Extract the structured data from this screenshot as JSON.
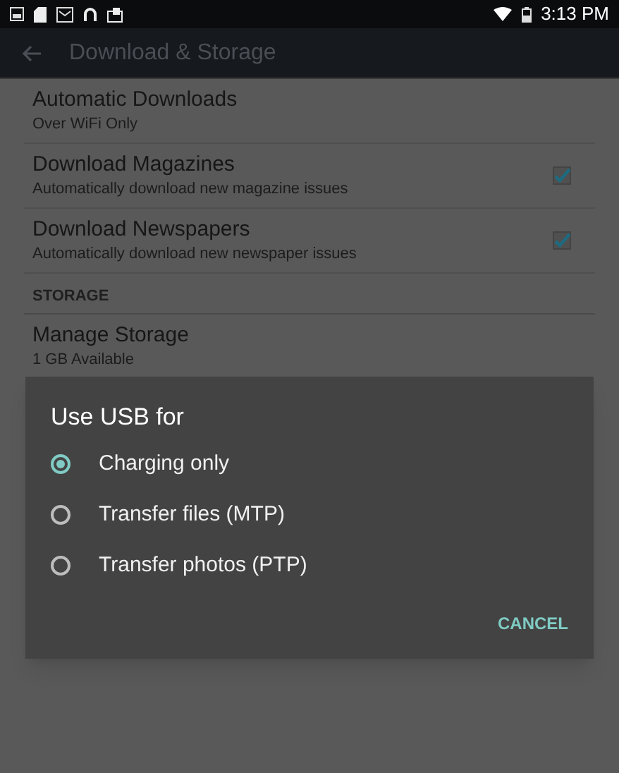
{
  "status_bar": {
    "time": "3:13 PM"
  },
  "toolbar": {
    "title": "Download & Storage"
  },
  "settings": [
    {
      "kind": "item",
      "title": "Automatic Downloads",
      "summary": "Over WiFi Only"
    },
    {
      "kind": "checkbox",
      "title": "Download Magazines",
      "summary": "Automatically download new magazine issues",
      "checked": true
    },
    {
      "kind": "checkbox",
      "title": "Download Newspapers",
      "summary": "Automatically download new newspaper issues",
      "checked": true
    },
    {
      "kind": "header",
      "title": "STORAGE"
    },
    {
      "kind": "item",
      "title": "Manage Storage",
      "summary": "1 GB Available"
    }
  ],
  "dialog": {
    "title": "Use USB for",
    "options": [
      {
        "label": "Charging only",
        "selected": true
      },
      {
        "label": "Transfer files (MTP)",
        "selected": false
      },
      {
        "label": "Transfer photos (PTP)",
        "selected": false
      }
    ],
    "buttons": [
      "CANCEL"
    ]
  }
}
